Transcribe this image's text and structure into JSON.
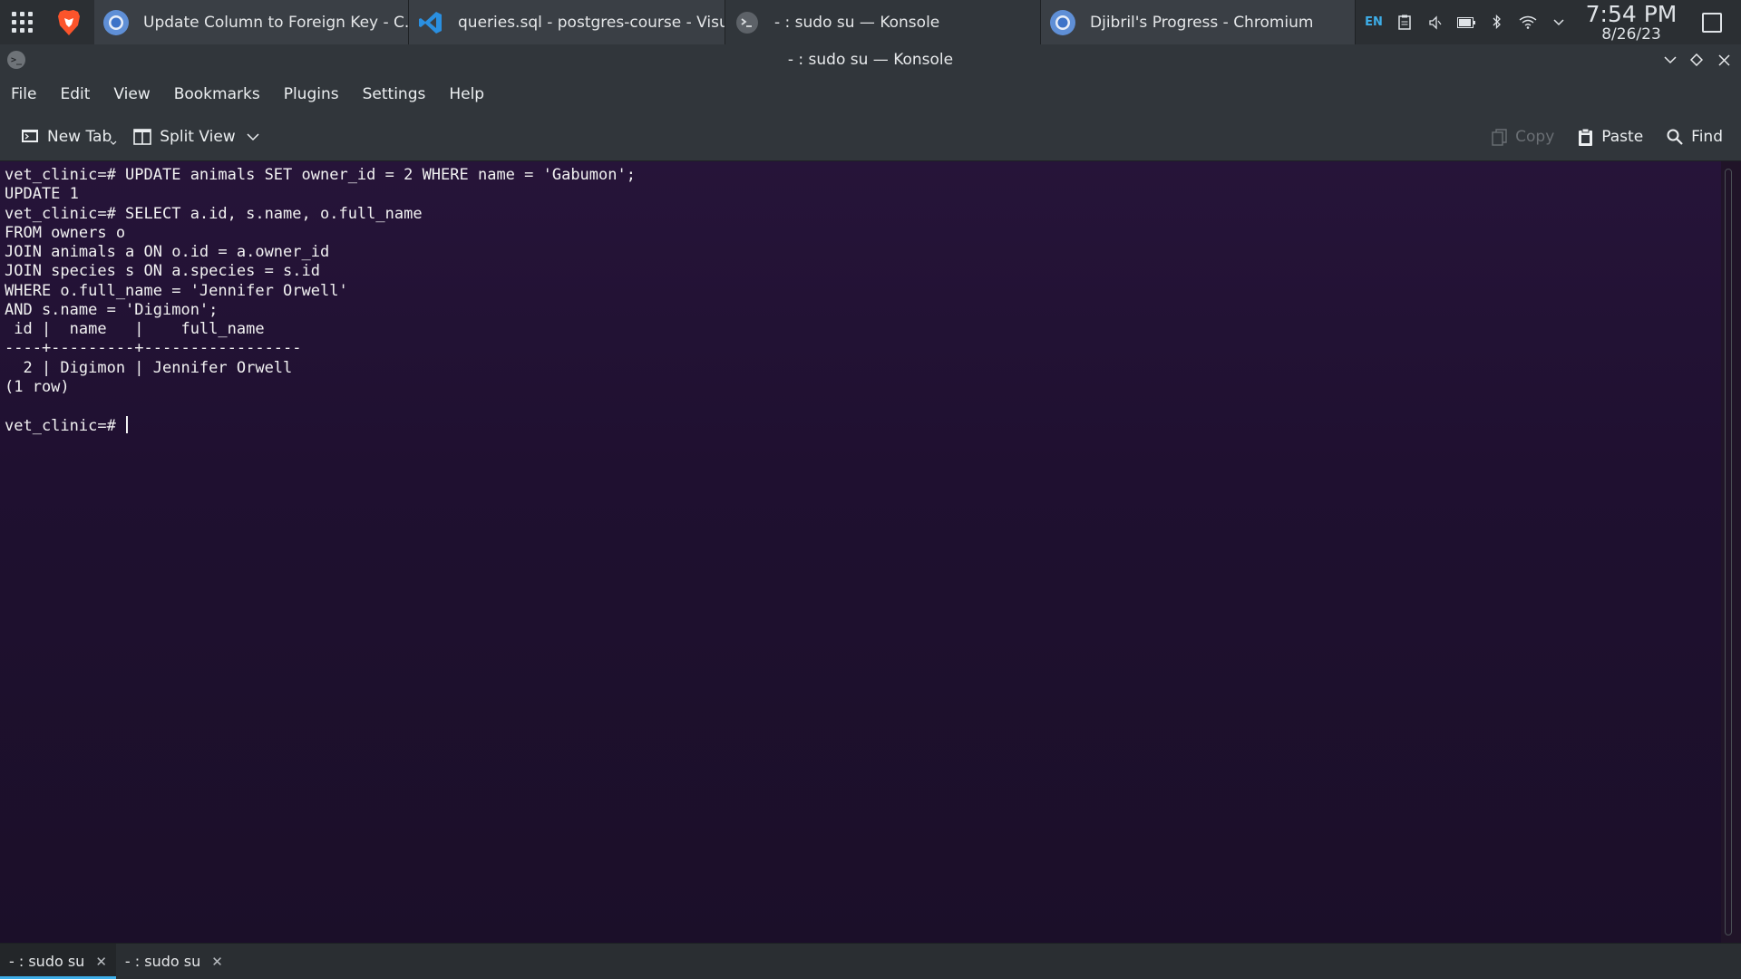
{
  "taskbar": {
    "tasks": [
      {
        "label": "Update Column to Foreign Key - C...",
        "icon": "chromium-icon"
      },
      {
        "label": "queries.sql - postgres-course - Visu...",
        "icon": "vscode-icon"
      },
      {
        "label": "- : sudo su — Konsole",
        "icon": "konsole-icon"
      },
      {
        "label": "Djibril's Progress - Chromium",
        "icon": "chromium-icon"
      }
    ],
    "tray": {
      "keyboard_layout": "EN",
      "time": "7:54 PM",
      "date": "8/26/23"
    }
  },
  "window": {
    "title": "- : sudo su — Konsole"
  },
  "menu": [
    "File",
    "Edit",
    "View",
    "Bookmarks",
    "Plugins",
    "Settings",
    "Help"
  ],
  "toolbar": {
    "new_tab": "New Tab",
    "split_view": "Split View",
    "copy": "Copy",
    "paste": "Paste",
    "find": "Find"
  },
  "terminal": {
    "lines": [
      "vet_clinic=# UPDATE animals SET owner_id = 2 WHERE name = 'Gabumon';",
      "UPDATE 1",
      "vet_clinic=# SELECT a.id, s.name, o.full_name",
      "FROM owners o",
      "JOIN animals a ON o.id = a.owner_id",
      "JOIN species s ON a.species = s.id",
      "WHERE o.full_name = 'Jennifer Orwell'",
      "AND s.name = 'Digimon';",
      " id |  name   |    full_name",
      "----+---------+-----------------",
      "  2 | Digimon | Jennifer Orwell",
      "(1 row)",
      ""
    ],
    "prompt": "vet_clinic=# "
  },
  "tabs": [
    {
      "label": "- : sudo su",
      "active": true
    },
    {
      "label": "- : sudo su",
      "active": false
    }
  ],
  "colors": {
    "accent": "#3daee9",
    "terminal_bg": "#1f1030",
    "chrome_bg": "#31363b"
  }
}
